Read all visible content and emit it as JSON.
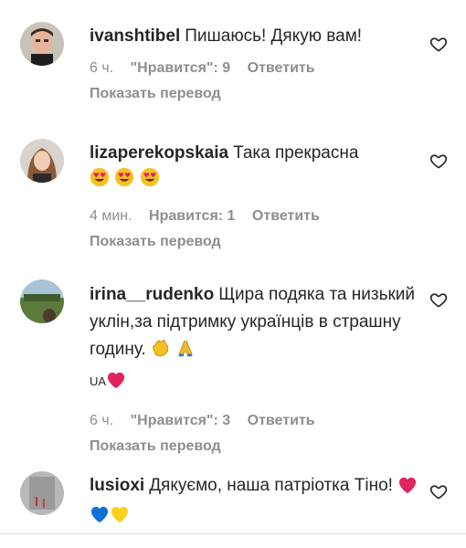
{
  "comments": [
    {
      "username": "ivanshtibel",
      "text": "Пишаюсь! Дякую вам!",
      "time": "6 ч.",
      "likes": "\"Нравится\": 9",
      "reply": "Ответить",
      "translate": "Показать перевод",
      "emoji": []
    },
    {
      "username": "lizaperekopskaia",
      "text": "Така прекрасна",
      "time": "4 мин.",
      "likes": "Нравится: 1",
      "reply": "Ответить",
      "translate": "Показать перевод",
      "emoji": [
        "heart-eyes-emoji",
        "heart-eyes-emoji",
        "heart-eyes-emoji"
      ]
    },
    {
      "username": "irina__rudenko",
      "text": "Щира подяка та низький уклін,за підтримку українців в страшну годину.",
      "text_end": "UA",
      "time": "6 ч.",
      "likes": "\"Нравится\": 3",
      "reply": "Ответить",
      "translate": "Показать перевод",
      "emoji": [
        "clapping-hands-emoji",
        "folded-hands-emoji",
        "red-heart-emoji"
      ]
    },
    {
      "username": "lusioxi",
      "text": "Дякуємо, наша патріотка Тіно!",
      "emoji": [
        "red-heart-emoji",
        "blue-heart-emoji",
        "yellow-heart-emoji"
      ]
    }
  ],
  "colors": {
    "text": "#262626",
    "secondary": "#8e8e8e",
    "red_heart": "#e0245e",
    "blue_heart": "#0a72d6",
    "yellow_heart": "#f7d21b"
  }
}
